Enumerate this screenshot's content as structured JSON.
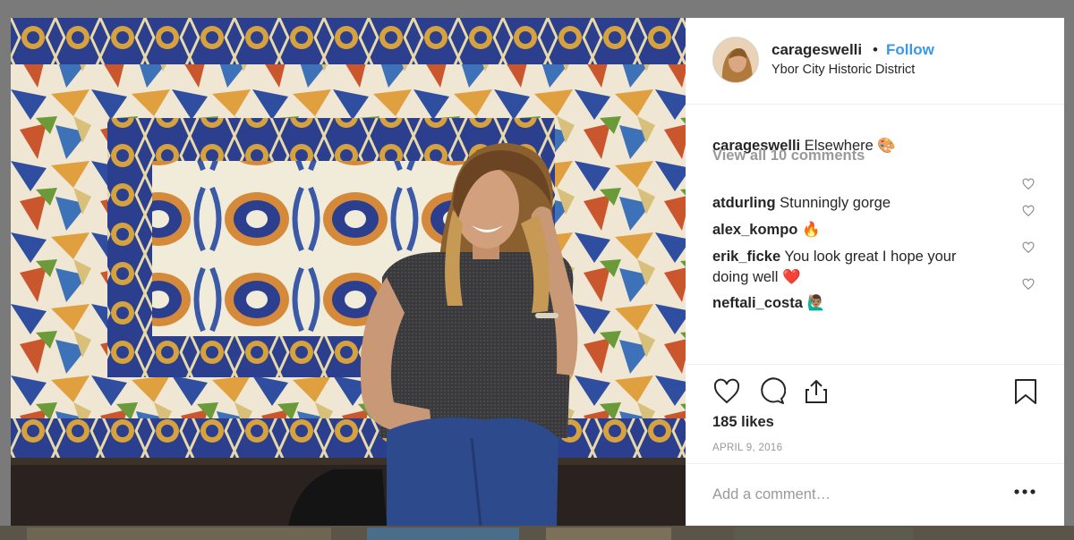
{
  "post": {
    "username": "carageswelli",
    "dot": "•",
    "follow_label": "Follow",
    "location": "Ybor City Historic District"
  },
  "caption": {
    "username": "carageswelli",
    "text": "Elsewhere 🎨"
  },
  "view_all_comments": "View all 10 comments",
  "comments": [
    {
      "username": "atdurling",
      "text": "Stunningly gorge"
    },
    {
      "username": "alex_kompo",
      "text": "🔥"
    },
    {
      "username": "erik_ficke",
      "text": "You look great I hope your",
      "text2": "doing well ❤️"
    },
    {
      "username": "neftali_costa",
      "text": "🙋🏽‍♂️"
    }
  ],
  "likes": "185 likes",
  "date": "APRIL 9, 2016",
  "add_comment": {
    "placeholder": "Add a comment…"
  },
  "icons": {
    "like": "heart-icon",
    "comment": "comment-bubble-icon",
    "share": "share-icon",
    "save": "bookmark-icon",
    "more": "ellipsis-icon"
  },
  "colors": {
    "link": "#3897f0",
    "text": "#262626",
    "muted": "#999999",
    "divider": "#efefef",
    "tile_blue": "#2c3f8f",
    "tile_gold": "#d6a23d"
  }
}
